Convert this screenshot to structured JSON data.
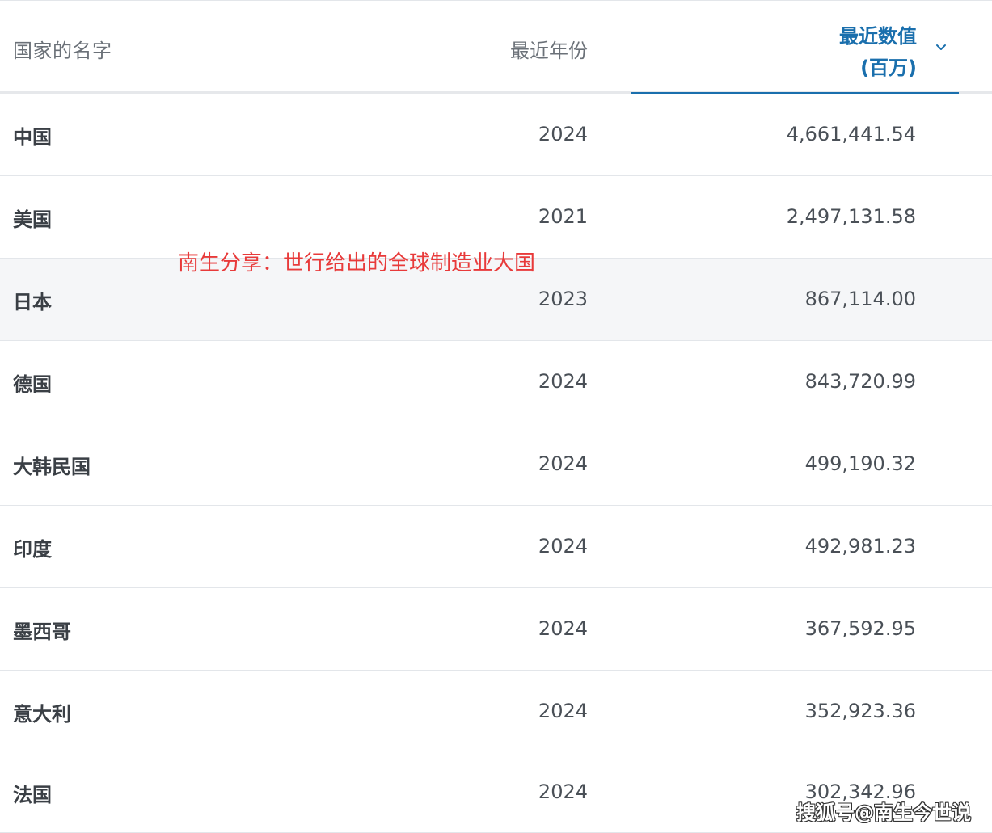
{
  "table": {
    "headers": {
      "name": "国家的名字",
      "year": "最近年份",
      "value_line1": "最近数值",
      "value_line2": "(百万)"
    },
    "sort_icon": "chevron-down-icon",
    "accent_color": "#1a6fad",
    "rows": [
      {
        "name": "中国",
        "year": "2024",
        "value": "4,661,441.54"
      },
      {
        "name": "美国",
        "year": "2021",
        "value": "2,497,131.58"
      },
      {
        "name": "日本",
        "year": "2023",
        "value": "867,114.00"
      },
      {
        "name": "德国",
        "year": "2024",
        "value": "843,720.99"
      },
      {
        "name": "大韩民国",
        "year": "2024",
        "value": "499,190.32"
      },
      {
        "name": "印度",
        "year": "2024",
        "value": "492,981.23"
      },
      {
        "name": "墨西哥",
        "year": "2024",
        "value": "367,592.95"
      },
      {
        "name": "意大利",
        "year": "2024",
        "value": "352,923.36"
      },
      {
        "name": "法国",
        "year": "2024",
        "value": "302,342.96"
      }
    ]
  },
  "overlay": {
    "caption": "南生分享：世行给出的全球制造业大国",
    "caption_color": "#e83a3a",
    "watermark": "搜狐号@南生今世说"
  }
}
